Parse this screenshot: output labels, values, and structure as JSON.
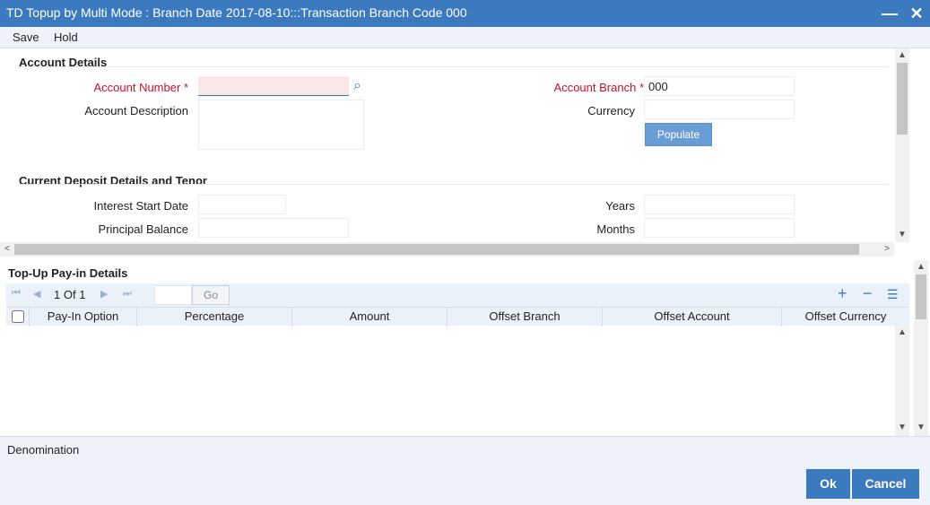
{
  "window": {
    "title": "TD Topup by Multi Mode : Branch Date 2017-08-10:::Transaction Branch Code 000",
    "minimize_glyph": "—",
    "close_glyph": "✕"
  },
  "menu": {
    "save": "Save",
    "hold": "Hold"
  },
  "account_details": {
    "heading": "Account Details",
    "account_number_label": "Account Number",
    "required_mark": "*",
    "account_number_value": "",
    "account_description_label": "Account Description",
    "account_branch_label": "Account Branch",
    "account_branch_value": "000",
    "currency_label": "Currency",
    "populate_label": "Populate",
    "search_icon": "⌕"
  },
  "deposit": {
    "heading": "Current Deposit Details and Tenor",
    "interest_start_date_label": "Interest Start Date",
    "principal_balance_label": "Principal Balance",
    "years_label": "Years",
    "months_label": "Months"
  },
  "payin": {
    "heading": "Top-Up Pay-in Details",
    "page_current": "1",
    "page_of": "Of",
    "page_total": "1",
    "go_label": "Go",
    "first_icon": "⏮",
    "prev_icon": "◀",
    "next_icon": "▶",
    "last_icon": "⏭",
    "add_icon": "+",
    "remove_icon": "−",
    "list_icon": "☰",
    "columns": [
      "Pay-In Option",
      "Percentage",
      "Amount",
      "Offset Branch",
      "Offset Account",
      "Offset Currency"
    ]
  },
  "denomination": {
    "label": "Denomination"
  },
  "footer": {
    "ok": "Ok",
    "cancel": "Cancel"
  },
  "scroll_glyphs": {
    "up": "▲",
    "down": "▼",
    "left": "<",
    "right": ">"
  },
  "colors": {
    "titlebar": "#3c7ac0",
    "required": "#c8102e",
    "button": "#3c7ac0"
  }
}
